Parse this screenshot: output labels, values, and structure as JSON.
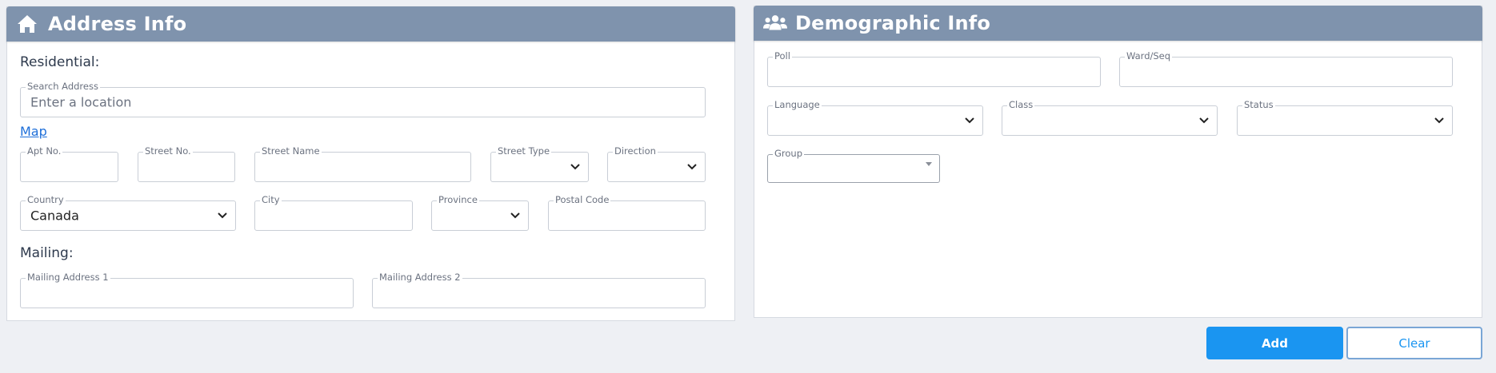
{
  "address": {
    "title": "Address Info",
    "residential_label": "Residential:",
    "search_label": "Search Address",
    "search_placeholder": "Enter a location",
    "map_link": "Map",
    "apt_label": "Apt No.",
    "street_no_label": "Street No.",
    "street_name_label": "Street Name",
    "street_type_label": "Street Type",
    "direction_label": "Direction",
    "country_label": "Country",
    "country_value": "Canada",
    "city_label": "City",
    "province_label": "Province",
    "postal_label": "Postal Code",
    "mailing_label": "Mailing:",
    "mailing1_label": "Mailing Address 1",
    "mailing2_label": "Mailing Address 2"
  },
  "demographic": {
    "title": "Demographic Info",
    "poll_label": "Poll",
    "ward_label": "Ward/Seq",
    "language_label": "Language",
    "class_label": "Class",
    "status_label": "Status",
    "group_label": "Group"
  },
  "actions": {
    "add_label": "Add",
    "clear_label": "Clear"
  },
  "colors": {
    "header_bg": "#7f93ad",
    "accent": "#1a95f1",
    "link": "#1e6fd9"
  },
  "icons": {
    "address": "home-icon",
    "demographic": "users-icon",
    "select": "chevron-down-icon"
  }
}
